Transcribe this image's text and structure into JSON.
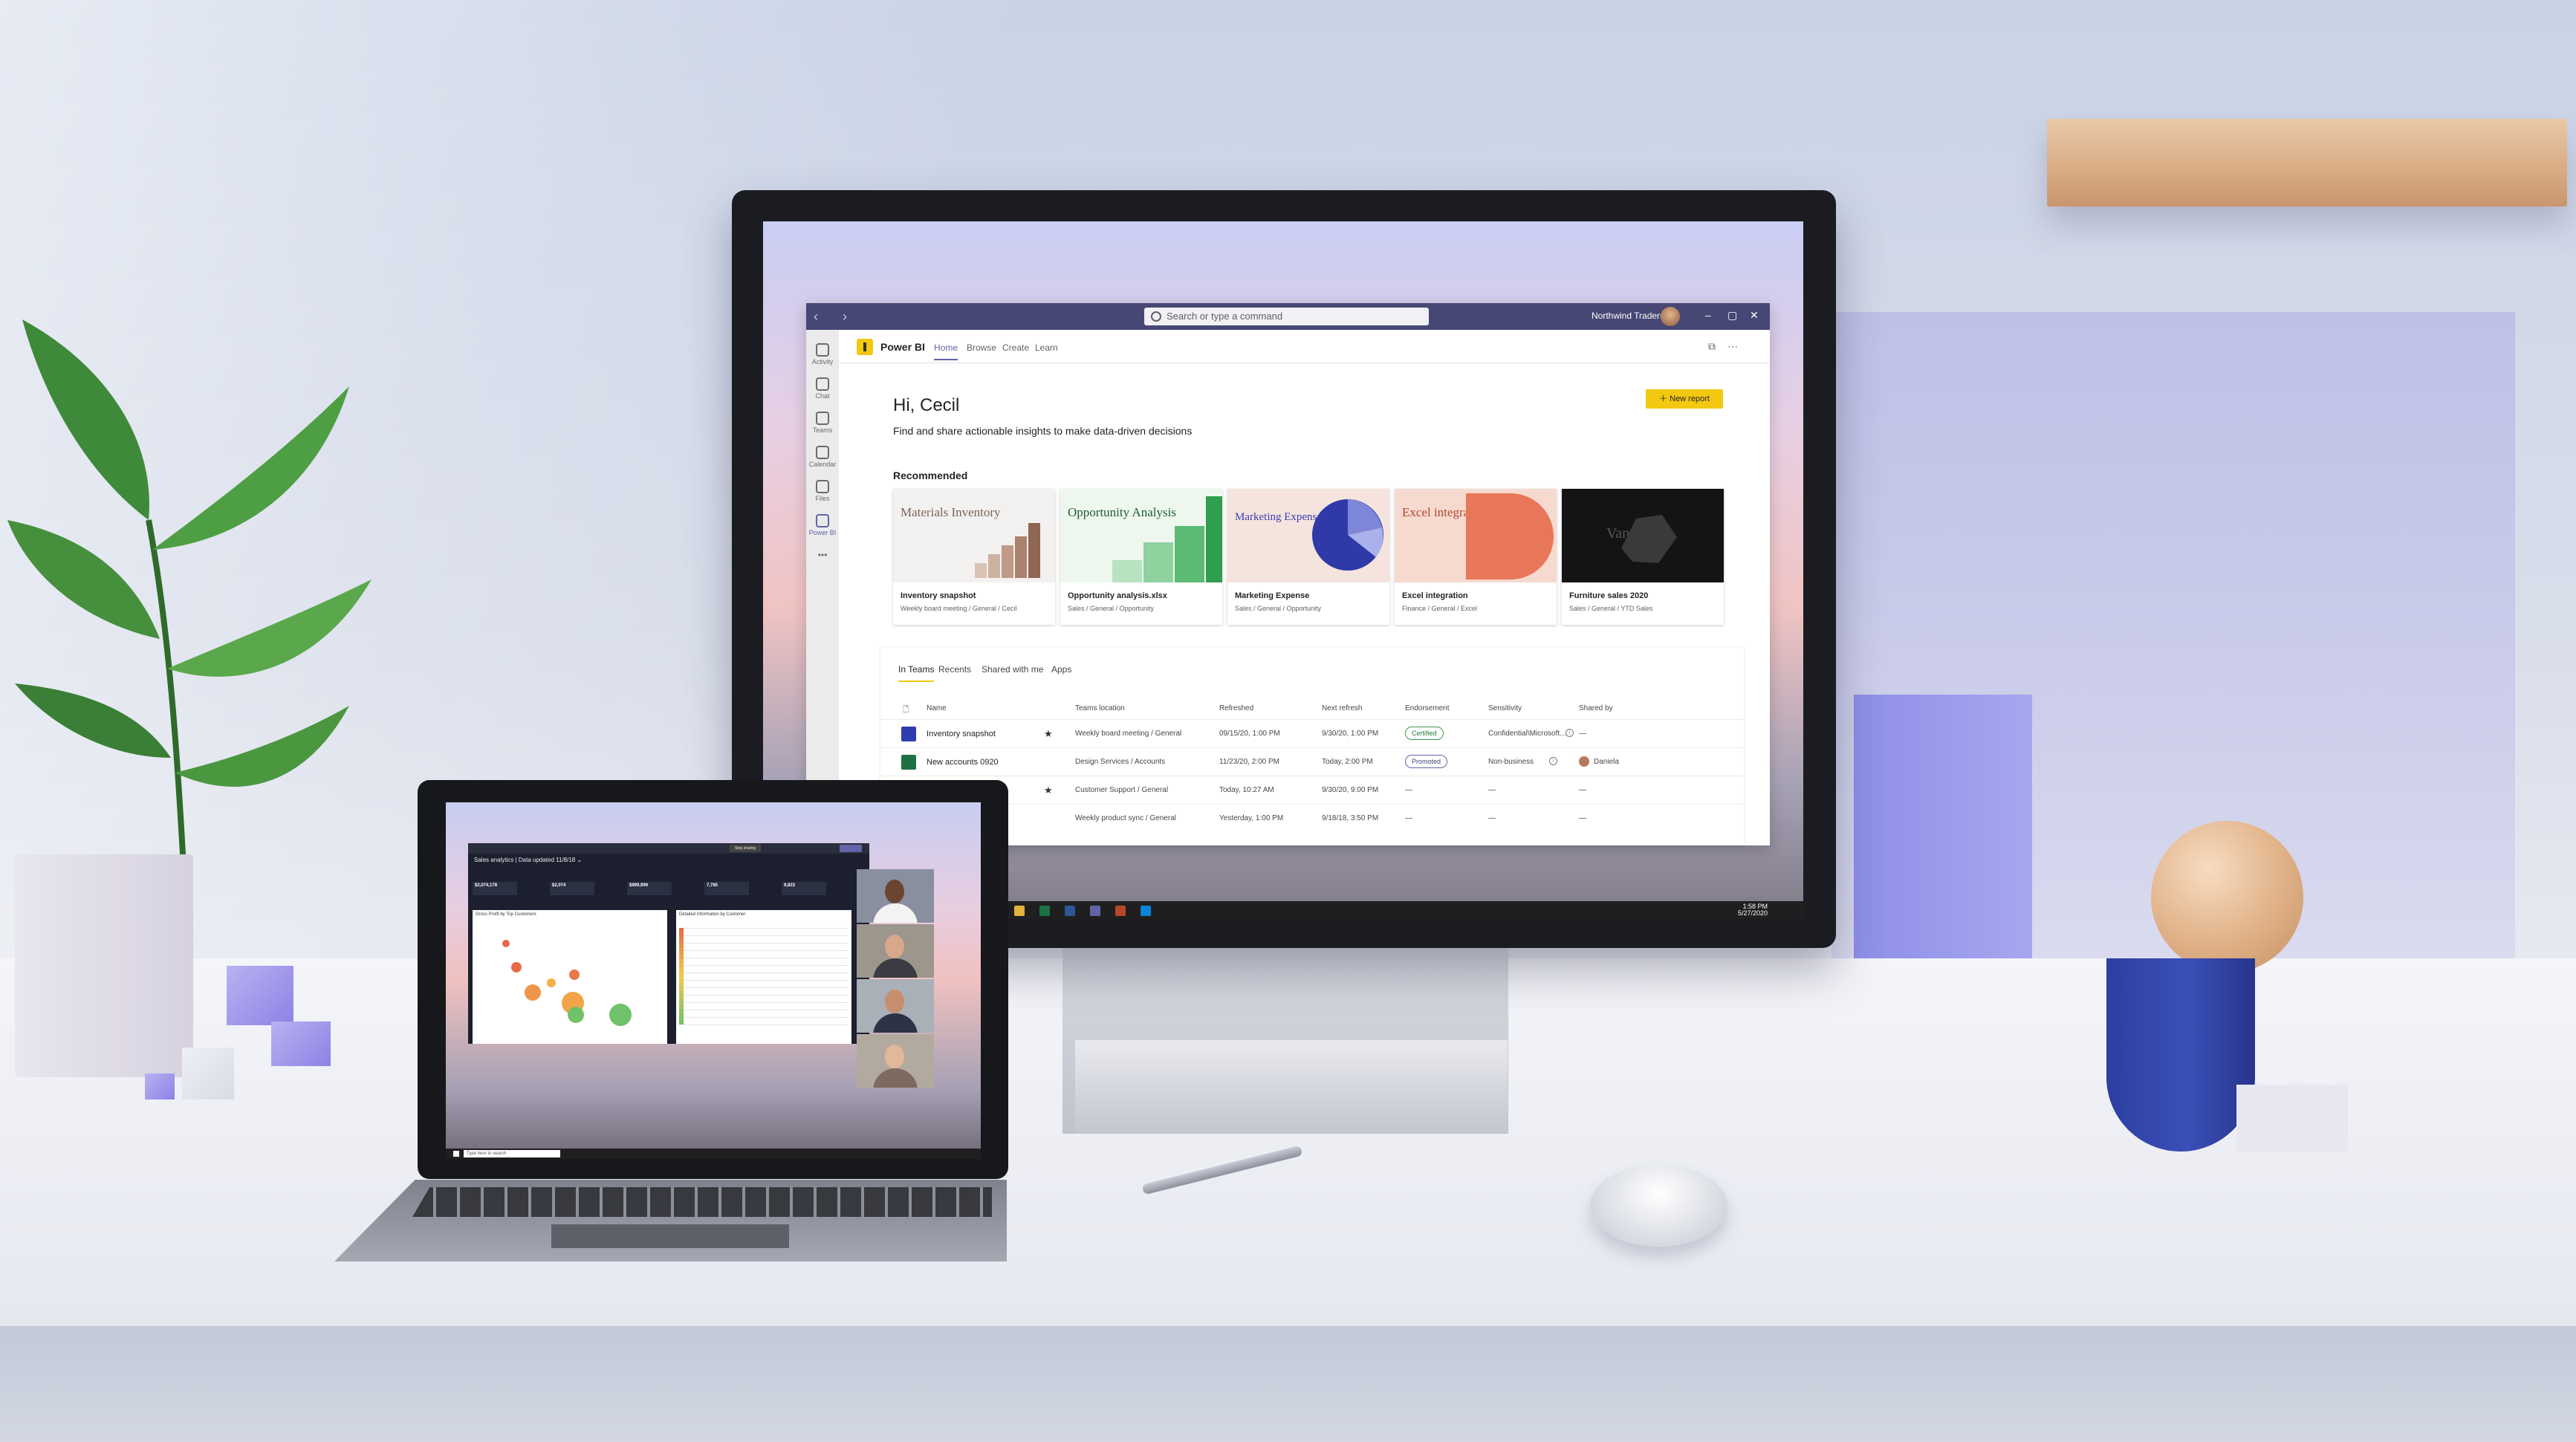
{
  "colors": {
    "teams_header": "#464775",
    "teams_accent": "#6264a7",
    "powerbi_yellow": "#f2c811",
    "rail_bg": "#ebebeb",
    "laptop_app_bg": "#1c1f2e"
  },
  "teams": {
    "search_placeholder": "Search or type a command",
    "org_name": "Northwind Traders ⌄",
    "rail": [
      {
        "label": "Activity",
        "icon": "bell-icon"
      },
      {
        "label": "Chat",
        "icon": "chat-icon"
      },
      {
        "label": "Teams",
        "icon": "teams-icon"
      },
      {
        "label": "Calendar",
        "icon": "calendar-icon"
      },
      {
        "label": "Files",
        "icon": "file-icon"
      },
      {
        "label": "Power BI",
        "icon": "powerbi-icon"
      },
      {
        "label": "•••",
        "icon": "more-icon"
      }
    ]
  },
  "powerbi": {
    "app_name": "Power BI",
    "tabs": [
      "Home",
      "Browse",
      "Create",
      "Learn"
    ],
    "active_tab": "Home",
    "greeting": "Hi, Cecil",
    "subtitle": "Find and share actionable insights to make data-driven decisions",
    "new_report": "New report",
    "recommended_title": "Recommended",
    "recommended": [
      {
        "thumb_title": "Materials Inventory",
        "name": "Inventory snapshot",
        "path": "Weekly board meeting / General / Cecil"
      },
      {
        "thumb_title": "Opportunity Analysis",
        "name": "Opportunity analysis.xlsx",
        "path": "Sales / General / Opportunity"
      },
      {
        "thumb_title": "Marketing Expense",
        "name": "Marketing Expense",
        "path": "Sales / General / Opportunity"
      },
      {
        "thumb_title": "Excel integration",
        "name": "Excel integration",
        "path": "Finance / General / Excel"
      },
      {
        "thumb_title": "VanArsdel",
        "name": "Furniture sales 2020",
        "path": "Sales / General / YTD Sales"
      }
    ],
    "list_tabs": [
      "In Teams",
      "Recents",
      "Shared with me",
      "Apps"
    ],
    "active_list_tab": "In Teams",
    "columns": [
      "Name",
      "Teams location",
      "Refreshed",
      "Next refresh",
      "Endorsement",
      "Sensitivity",
      "Shared by"
    ],
    "rows": [
      {
        "name": "Inventory snapshot",
        "starred": true,
        "location": "Weekly board meeting / General",
        "refreshed": "09/15/20, 1:00 PM",
        "next": "9/30/20, 1:00 PM",
        "endorsement": "Certified",
        "sensitivity": "Confidential\\Microsoft...",
        "shared_by": "—",
        "icon": "powerbi-report-icon"
      },
      {
        "name": "New accounts 0920",
        "starred": false,
        "location": "Design Services / Accounts",
        "refreshed": "11/23/20, 2:00 PM",
        "next": "Today, 2:00 PM",
        "endorsement": "Promoted",
        "sensitivity": "Non-business",
        "shared_by": "Daniela",
        "icon": "excel-icon"
      },
      {
        "name": "",
        "starred": true,
        "location": "Customer Support / General",
        "refreshed": "Today, 10:27 AM",
        "next": "9/30/20, 9:00 PM",
        "endorsement": "—",
        "sensitivity": "—",
        "shared_by": "—",
        "icon": ""
      },
      {
        "name": "",
        "starred": false,
        "location": "Weekly product sync / General",
        "refreshed": "Yesterday, 1:00 PM",
        "next": "9/18/18, 3:50 PM",
        "endorsement": "—",
        "sensitivity": "—",
        "shared_by": "—",
        "icon": ""
      }
    ]
  },
  "taskbar": {
    "time": "1:58 PM",
    "date": "5/27/2020"
  },
  "laptop_app": {
    "title": "Sales analytics | Data updated 11/8/18 ⌄",
    "stop_sharing": "Stop sharing",
    "kpis": [
      "$2,074,178",
      "$2,074",
      "$999,999",
      "7,785",
      "9,823"
    ],
    "chart_left_title": "Gross Profit by Top Customers",
    "chart_right_title": "Detailed Information by Customer",
    "search_placeholder": "Type here to search"
  }
}
